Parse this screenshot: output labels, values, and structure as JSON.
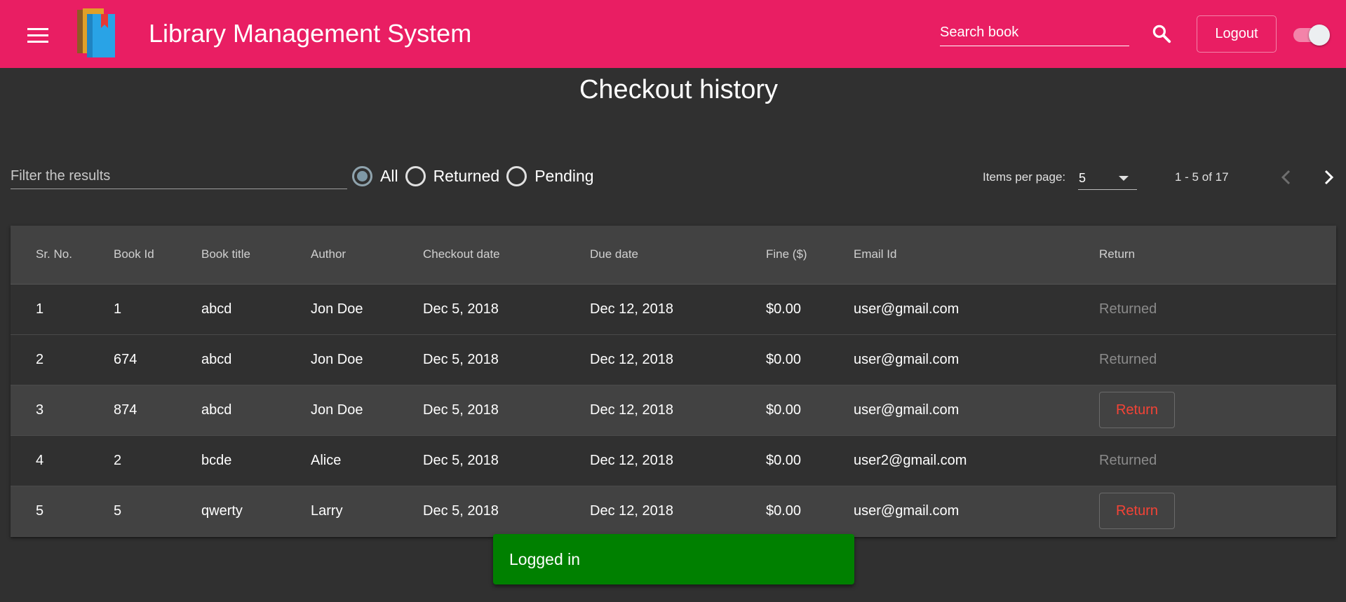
{
  "header": {
    "title": "Library Management System",
    "search_placeholder": "Search book",
    "logout_label": "Logout",
    "colors": {
      "toolbar": "#e91e63",
      "background": "#303030"
    },
    "icons": {
      "menu": "menu-icon",
      "logo": "books-logo",
      "search": "search-icon"
    }
  },
  "page": {
    "title": "Checkout history"
  },
  "filters": {
    "filter_placeholder": "Filter the results",
    "radios": [
      {
        "label": "All",
        "checked": true
      },
      {
        "label": "Returned",
        "checked": false
      },
      {
        "label": "Pending",
        "checked": false
      }
    ]
  },
  "paginator": {
    "items_per_page_label": "Items per page:",
    "page_size": "5",
    "range_label": "1 - 5 of 17"
  },
  "table": {
    "columns": [
      "Sr. No.",
      "Book Id",
      "Book title",
      "Author",
      "Checkout date",
      "Due date",
      "Fine ($)",
      "Email Id",
      "Return"
    ],
    "rows": [
      {
        "sr": "1",
        "book_id": "1",
        "title": "abcd",
        "author": "Jon Doe",
        "checkout": "Dec 5, 2018",
        "due": "Dec 12, 2018",
        "fine": "$0.00",
        "email": "user@gmail.com",
        "status": "Returned"
      },
      {
        "sr": "2",
        "book_id": "674",
        "title": "abcd",
        "author": "Jon Doe",
        "checkout": "Dec 5, 2018",
        "due": "Dec 12, 2018",
        "fine": "$0.00",
        "email": "user@gmail.com",
        "status": "Returned"
      },
      {
        "sr": "3",
        "book_id": "874",
        "title": "abcd",
        "author": "Jon Doe",
        "checkout": "Dec 5, 2018",
        "due": "Dec 12, 2018",
        "fine": "$0.00",
        "email": "user@gmail.com",
        "status": "Return"
      },
      {
        "sr": "4",
        "book_id": "2",
        "title": "bcde",
        "author": "Alice",
        "checkout": "Dec 5, 2018",
        "due": "Dec 12, 2018",
        "fine": "$0.00",
        "email": "user2@gmail.com",
        "status": "Returned"
      },
      {
        "sr": "5",
        "book_id": "5",
        "title": "qwerty",
        "author": "Larry",
        "checkout": "Dec 5, 2018",
        "due": "Dec 12, 2018",
        "fine": "$0.00",
        "email": "user@gmail.com",
        "status": "Return"
      }
    ]
  },
  "snackbar": {
    "message": "Logged in",
    "color": "#008000"
  }
}
